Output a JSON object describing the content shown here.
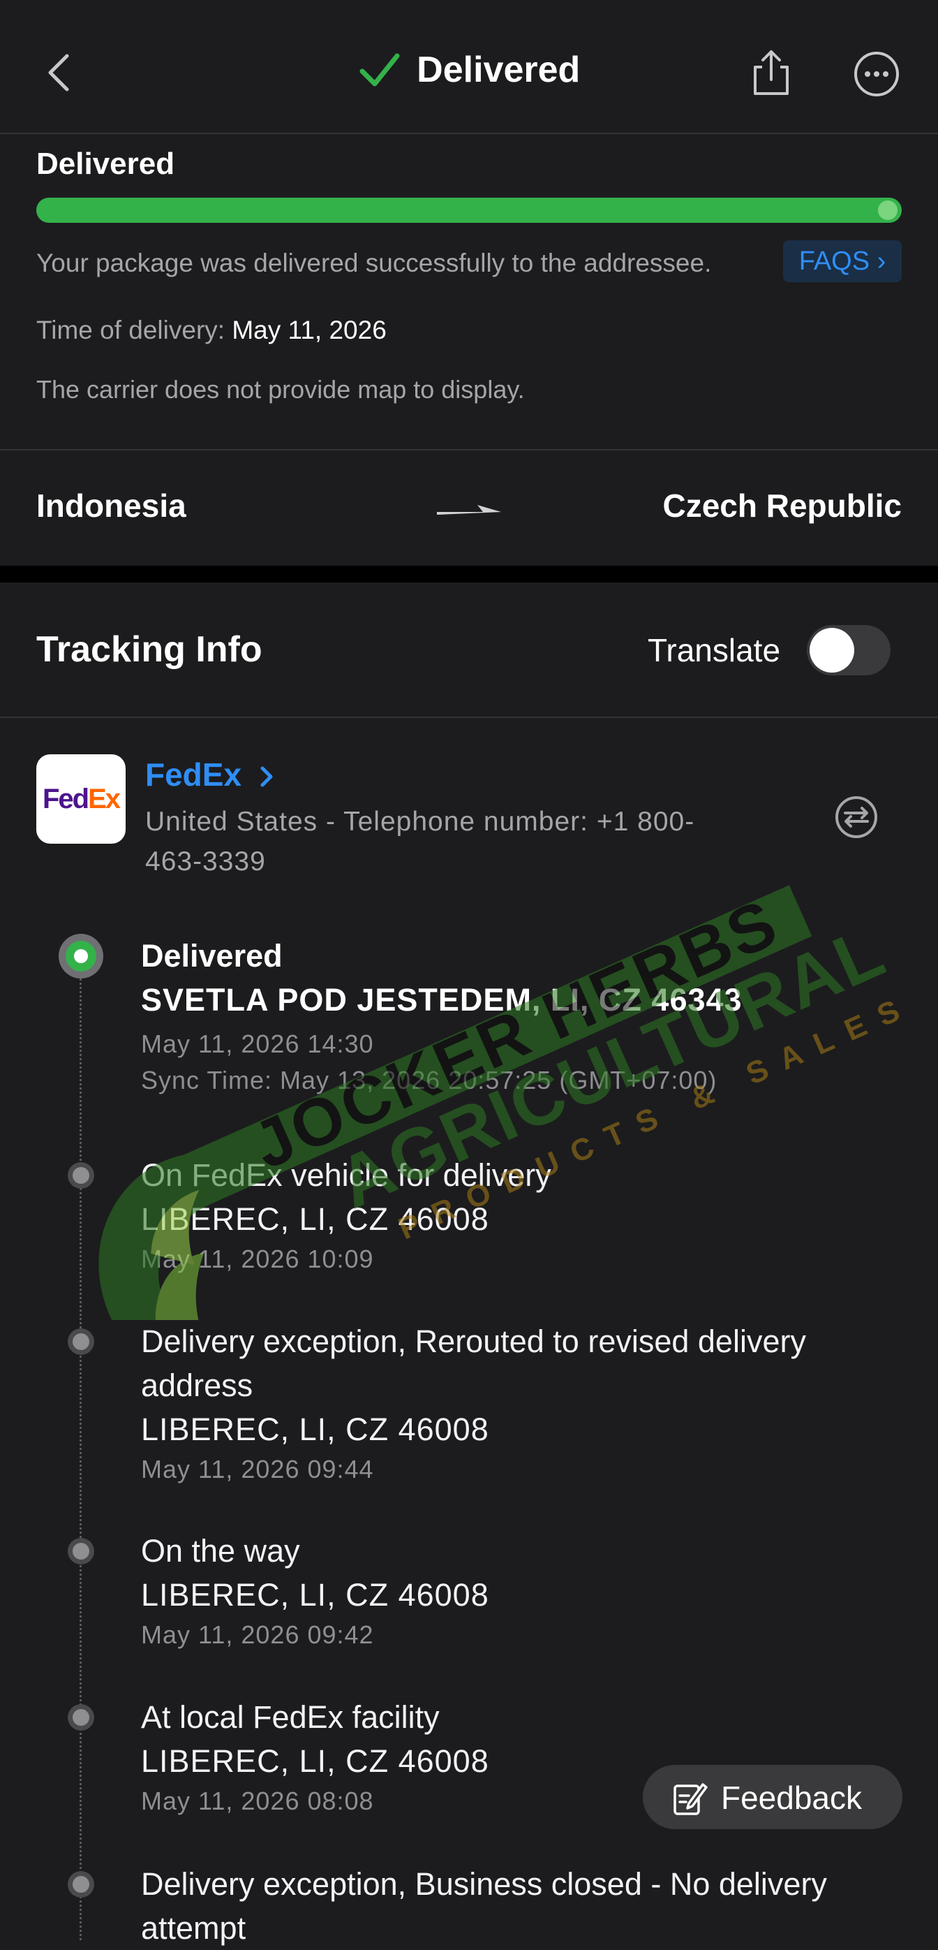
{
  "header": {
    "title": "Delivered",
    "accent_color": "#34b24a",
    "icons": [
      "chevron-left-icon",
      "checkmark-icon",
      "share-icon",
      "more-icon"
    ]
  },
  "summary": {
    "status_heading": "Delivered",
    "progress_percent": 100,
    "description": "Your package was delivered successfully to the addressee.",
    "faq_label": "FAQS ›",
    "time_label": "Time of delivery:",
    "time_value": "May 11, 2026",
    "map_note": "The carrier does not provide map to display."
  },
  "route": {
    "origin": "Indonesia",
    "destination": "Czech Republic"
  },
  "tracking": {
    "title": "Tracking Info",
    "translate_label": "Translate",
    "translate_on": false
  },
  "carrier": {
    "logo_fed": "Fed",
    "logo_ex": "Ex",
    "name": "FedEx",
    "contact": "United States - Telephone number: +1 800-463-3339"
  },
  "events": [
    {
      "status": "Delivered",
      "location": "SVETLA POD JESTEDEM, LI, CZ 46343",
      "time": "May 11, 2026 14:30",
      "sync_time": "Sync Time: May 13, 2026 20:57:25 (GMT+07:00)"
    },
    {
      "status": "On FedEx vehicle for delivery",
      "location": "LIBEREC, LI, CZ 46008",
      "time": "May 11, 2026 10:09"
    },
    {
      "status": "Delivery exception, Rerouted to revised delivery address",
      "location": "LIBEREC, LI, CZ 46008",
      "time": "May 11, 2026 09:44"
    },
    {
      "status": "On the way",
      "location": "LIBEREC, LI, CZ 46008",
      "time": "May 11, 2026 09:42"
    },
    {
      "status": "At local FedEx facility",
      "location": "LIBEREC, LI, CZ 46008",
      "time": "May 11, 2026 08:08"
    },
    {
      "status": "Delivery exception, Business closed - No delivery attempt",
      "location": "",
      "time": ""
    }
  ],
  "watermark": {
    "line1": "JOCKER HERBS",
    "line2": "AGRICULTURAL",
    "line3": "PRODUCTS & SALES"
  },
  "feedback": {
    "label": "Feedback"
  }
}
